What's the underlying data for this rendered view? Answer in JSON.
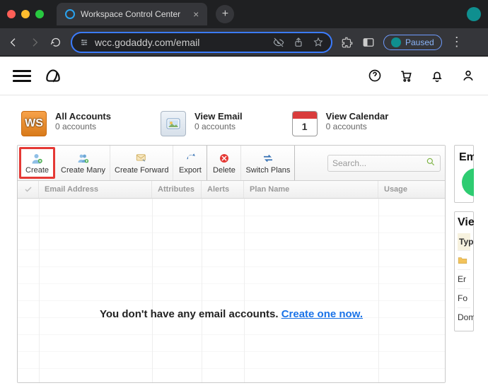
{
  "browser": {
    "tab_title": "Workspace Control Center",
    "url": "wcc.godaddy.com/email",
    "profile_status": "Paused"
  },
  "summary": {
    "accounts": {
      "title": "All Accounts",
      "sub": "0 accounts",
      "badge": "WS"
    },
    "email": {
      "title": "View Email",
      "sub": "0 accounts"
    },
    "calendar": {
      "title": "View Calendar",
      "sub": "0 accounts",
      "day": "1"
    }
  },
  "toolbar": {
    "create": "Create",
    "create_many": "Create Many",
    "create_forward": "Create Forward",
    "export": "Export",
    "delete": "Delete",
    "switch_plans": "Switch Plans",
    "search_placeholder": "Search..."
  },
  "columns": {
    "email": "Email Address",
    "attributes": "Attributes",
    "alerts": "Alerts",
    "plan": "Plan Name",
    "usage": "Usage"
  },
  "empty": {
    "prefix": "You don't have any email accounts. ",
    "link": "Create one now."
  },
  "side": {
    "top_heading": "Em",
    "view_heading": "Vie",
    "type_label": "Typ",
    "rows": [
      "Er",
      "Fo",
      "Dom"
    ]
  }
}
